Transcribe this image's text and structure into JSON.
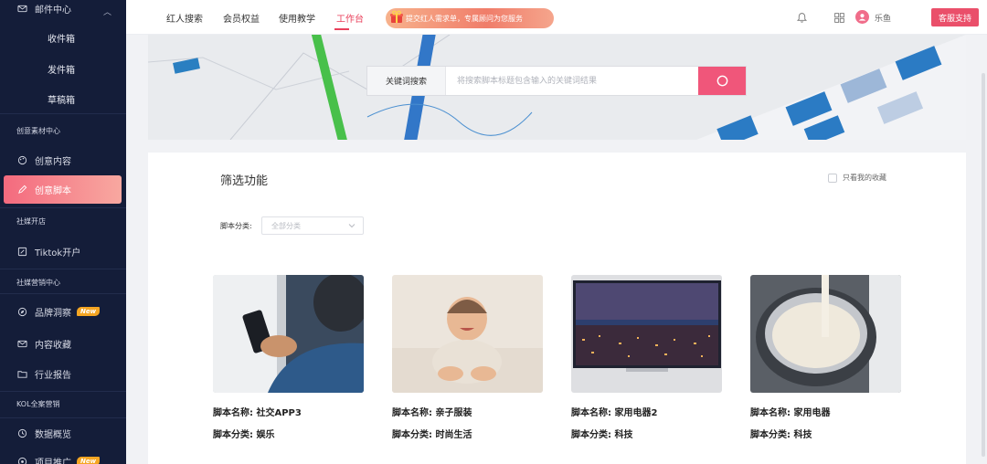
{
  "sidebar": {
    "mail_center": "邮件中心",
    "mail_items": [
      "收件箱",
      "发件箱",
      "草稿箱"
    ],
    "section_creative": "创意素材中心",
    "creative_content": "创意内容",
    "creative_script": "创意脚本",
    "section_social": "社媒开店",
    "tiktok_shop": "Tiktok开户",
    "section_marketing": "社媒营销中心",
    "brand_monitor": "品牌洞察",
    "content_favorites": "内容收藏",
    "industry_report": "行业报告",
    "section_kol": "KOL全案营销",
    "data_overview": "数据概览",
    "project_promotion": "项目推广",
    "new_badge": "New"
  },
  "topnav": {
    "items": [
      "红人搜索",
      "会员权益",
      "使用教学",
      "工作台"
    ],
    "active_index": 3,
    "promo_text": "提交红人需求单，专属顾问为您服务",
    "user_name": "乐鱼",
    "support_label": "客服支持"
  },
  "search": {
    "tag_label": "关键词搜索",
    "placeholder": "将搜索脚本标题包含输入的关键词结果"
  },
  "filter": {
    "title": "筛选功能",
    "fav_only": "只看我的收藏",
    "category_label": "脚本分类:",
    "category_placeholder": "全部分类"
  },
  "scripts": [
    {
      "name": "脚本名称: 社交APP3",
      "category": "脚本分类: 娱乐",
      "thumb": "phone-scene"
    },
    {
      "name": "脚本名称: 亲子服装",
      "category": "脚本分类: 时尚生活",
      "thumb": "baby-scene"
    },
    {
      "name": "脚本名称: 家用电器2",
      "category": "脚本分类: 科技",
      "thumb": "tv-scene"
    },
    {
      "name": "脚本名称: 家用电器",
      "category": "脚本分类: 科技",
      "thumb": "pot-scene"
    }
  ],
  "colors": {
    "sidebar_bg": "#141d39",
    "accent": "#ea4f6a",
    "search_btn": "#f0567a"
  }
}
